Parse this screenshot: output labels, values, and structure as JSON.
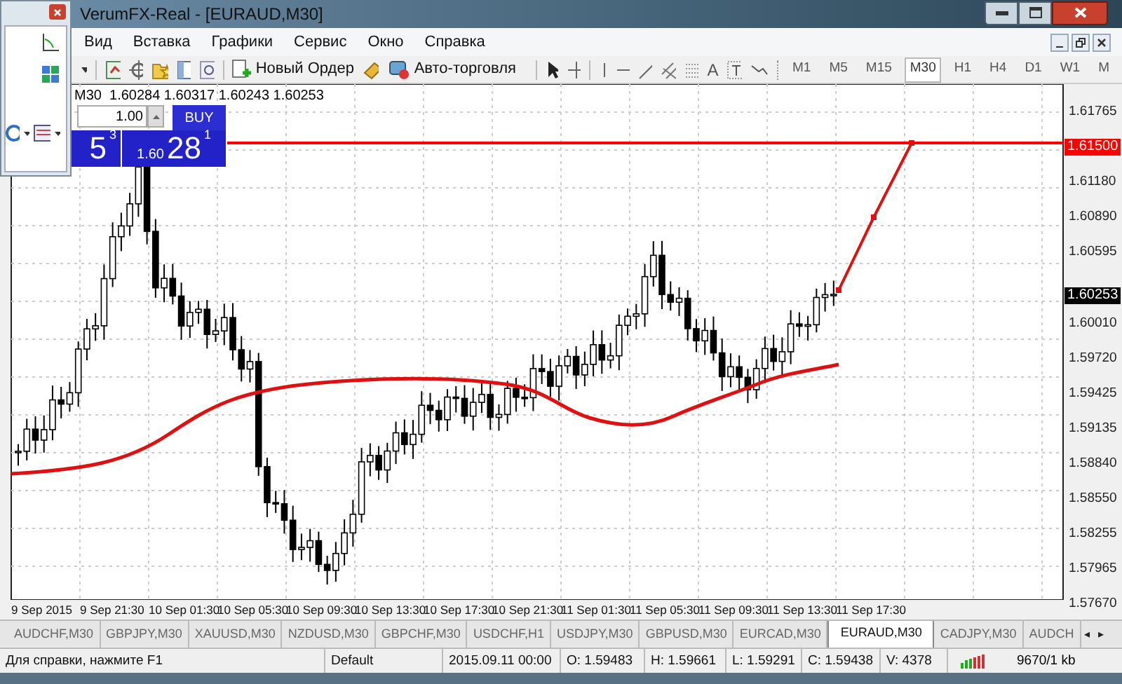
{
  "window": {
    "title": "VerumFX-Real - [EURAUD,M30]"
  },
  "menu": [
    "Вид",
    "Вставка",
    "Графики",
    "Сервис",
    "Окно",
    "Справка"
  ],
  "toolbar": {
    "new_order": "Новый Ордер",
    "autotrading": "Авто-торговля",
    "text_tool": "A",
    "periods": [
      {
        "label": "M1",
        "selected": false
      },
      {
        "label": "M5",
        "selected": false
      },
      {
        "label": "M15",
        "selected": false
      },
      {
        "label": "M30",
        "selected": true
      },
      {
        "label": "H1",
        "selected": false
      },
      {
        "label": "H4",
        "selected": false
      },
      {
        "label": "D1",
        "selected": false
      },
      {
        "label": "W1",
        "selected": false
      },
      {
        "label": "M",
        "selected": false
      }
    ]
  },
  "chart": {
    "header": "M30  1.60284 1.60317 1.60243 1.60253",
    "one_click": {
      "lots": "1.00",
      "buy_label": "BUY",
      "sell_main": "5",
      "sell_sup": "3",
      "buy_small": "1.60",
      "buy_main": "28",
      "buy_sup": "1"
    },
    "price_axis": {
      "groups": [
        [
          "1.61765"
        ],
        [
          "1.61180",
          "1.60890",
          "1.60595"
        ],
        [
          "1.60010",
          "1.59720",
          "1.59425",
          "1.59135",
          "1.58840",
          "1.58550",
          "1.58255",
          "1.57965",
          "1.57670"
        ]
      ],
      "level_label": "1.61500",
      "bid_label": "1.60253"
    },
    "time_labels": [
      "9 Sep 2015",
      "9 Sep 21:30",
      "10 Sep 01:30",
      "10 Sep 05:30",
      "10 Sep 09:30",
      "10 Sep 13:30",
      "10 Sep 17:30",
      "10 Sep 21:30",
      "11 Sep 01:30",
      "11 Sep 05:30",
      "11 Sep 09:30",
      "11 Sep 13:30",
      "11 Sep 17:30"
    ]
  },
  "tabs": [
    {
      "label": "AUDCHF,M30",
      "selected": false
    },
    {
      "label": "GBPJPY,M30",
      "selected": false
    },
    {
      "label": "XAUUSD,M30",
      "selected": false
    },
    {
      "label": "NZDUSD,M30",
      "selected": false
    },
    {
      "label": "GBPCHF,M30",
      "selected": false
    },
    {
      "label": "USDCHF,H1",
      "selected": false
    },
    {
      "label": "USDJPY,M30",
      "selected": false
    },
    {
      "label": "GBPUSD,M30",
      "selected": false
    },
    {
      "label": "EURCAD,M30",
      "selected": false
    },
    {
      "label": "EURAUD,M30",
      "selected": true
    },
    {
      "label": "CADJPY,M30",
      "selected": false
    },
    {
      "label": "AUDCH",
      "selected": false
    }
  ],
  "tab_scroll": [
    "◂",
    "▸"
  ],
  "status_bar": {
    "help": "Для справки, нажмите F1",
    "profile": "Default",
    "date": "2015.09.11 00:00",
    "open": "O: 1.59483",
    "high": "H: 1.59661",
    "low": "L: 1.59291",
    "close": "C: 1.59438",
    "volume": "V: 4378",
    "traffic": "9670/1 kb"
  }
}
